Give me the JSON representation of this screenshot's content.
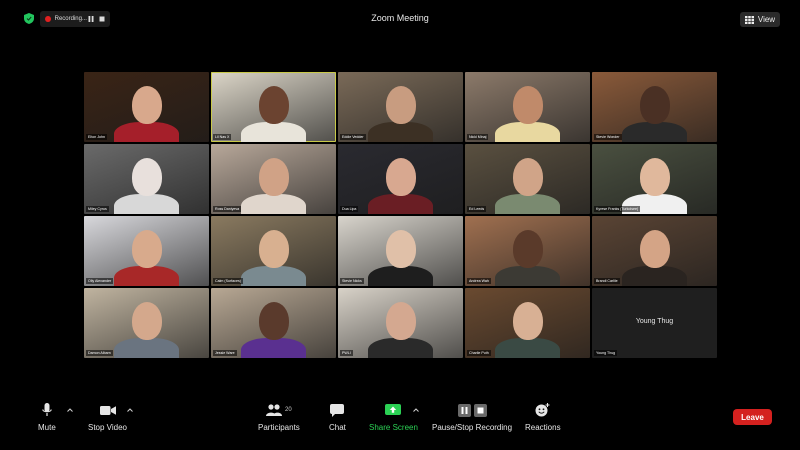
{
  "topbar": {
    "title": "Zoom Meeting",
    "recording_label": "Recording...",
    "view_label": "View",
    "icons": [
      "shield-icon",
      "record-dot-icon",
      "pause-icon",
      "stop-icon",
      "grid-icon"
    ]
  },
  "participants": [
    {
      "name": "Elton John",
      "bg": "#3a2416",
      "skin": "#d8a88c",
      "shirt": "#a51f2a"
    },
    {
      "name": "Lil Nas X",
      "bg": "#dcd6c8",
      "skin": "#6b4330",
      "shirt": "#e8e4da",
      "active": true
    },
    {
      "name": "Eddie Vedder",
      "bg": "#7a6a58",
      "skin": "#c89c80",
      "shirt": "#3c3024"
    },
    {
      "name": "Nicki Minaj",
      "bg": "#8c7a6a",
      "skin": "#c08a6a",
      "shirt": "#e8d8a0"
    },
    {
      "name": "Stevie Wonder",
      "bg": "#8a5a3a",
      "skin": "#4a3024",
      "shirt": "#2a2a2a"
    },
    {
      "name": "Miley Cyrus",
      "bg": "#6a6a6a",
      "skin": "#e8e0dc",
      "shirt": "#d8d8d8"
    },
    {
      "name": "Ross Daniyeva",
      "bg": "#b8a89a",
      "skin": "#d0a286",
      "shirt": "#e0d6cc"
    },
    {
      "name": "Dua Lipa",
      "bg": "#2a2a30",
      "skin": "#d8a890",
      "shirt": "#6a1e24"
    },
    {
      "name": "Ed Leeds",
      "bg": "#5a5040",
      "skin": "#d0a488",
      "shirt": "#7a8a70"
    },
    {
      "name": "Kyrese Franks (Turkoisee)",
      "bg": "#4a5040",
      "skin": "#e0b89c",
      "shirt": "#f0f0f0"
    },
    {
      "name": "Olly Alexander",
      "bg": "#d8d8dc",
      "skin": "#d8aa8c",
      "shirt": "#a82828"
    },
    {
      "name": "Calm (Surfaces)",
      "bg": "#8a7a60",
      "skin": "#d8b090",
      "shirt": "#7a8a90"
    },
    {
      "name": "Stevie Nicks",
      "bg": "#d8d4cc",
      "skin": "#e0c0a8",
      "shirt": "#1e1e1e"
    },
    {
      "name": "Andrea Wah",
      "bg": "#a07050",
      "skin": "#5a3a2a",
      "shirt": "#3c3a34"
    },
    {
      "name": "Brandi Carlile",
      "bg": "#5a4434",
      "skin": "#d4a486",
      "shirt": "#2a2420"
    },
    {
      "name": "Damon Albarn",
      "bg": "#c0b4a0",
      "skin": "#d4a88c",
      "shirt": "#6a7480"
    },
    {
      "name": "Jessie Ware",
      "bg": "#b8a894",
      "skin": "#5a3a2c",
      "shirt": "#5a3090"
    },
    {
      "name": "PWLI",
      "bg": "#d8d2c8",
      "skin": "#d4a890",
      "shirt": "#2a2a2a"
    },
    {
      "name": "Charlie Puth",
      "bg": "#6a4a30",
      "skin": "#d8b094",
      "shirt": "#3a4a44"
    },
    {
      "name": "Young Thug",
      "blank": true
    }
  ],
  "toolbar": {
    "mute": "Mute",
    "stop_video": "Stop Video",
    "participants": "Participants",
    "participants_count": "20",
    "chat": "Chat",
    "share_screen": "Share Screen",
    "pause_stop_recording": "Pause/Stop Recording",
    "reactions": "Reactions",
    "leave": "Leave",
    "accent_share": "#2bd154",
    "accent_leave": "#d4211f"
  }
}
